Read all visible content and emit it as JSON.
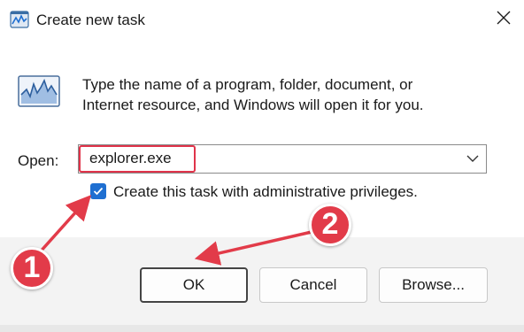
{
  "window": {
    "title": "Create new task",
    "close_icon": "close-icon"
  },
  "body": {
    "description_line1": "Type the name of a program, folder, document, or",
    "description_line2": "Internet resource, and Windows will open it for you.",
    "open_label": "Open:",
    "open_value": "explorer.exe",
    "admin_checkbox": {
      "label": "Create this task with administrative privileges.",
      "checked": true
    }
  },
  "buttons": {
    "ok": "OK",
    "cancel": "Cancel",
    "browse": "Browse..."
  },
  "annotations": {
    "step1": "1",
    "step2": "2",
    "color": "#e23b49"
  },
  "colors": {
    "accent": "#1f6fd1",
    "highlight": "#e0344a",
    "footer_bg": "#f3f3f3"
  }
}
